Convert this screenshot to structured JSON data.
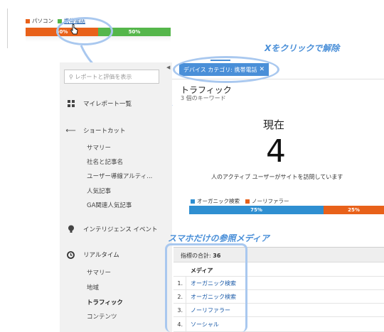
{
  "mini_chart": {
    "legend": [
      {
        "label": "パソコン",
        "color": "#e8611a"
      },
      {
        "label": "携帯電話",
        "color": "#55b64b"
      }
    ],
    "segments": [
      {
        "label": "50%",
        "value": 50,
        "color": "#e8611a"
      },
      {
        "label": "50%",
        "value": 50,
        "color": "#55b64b"
      }
    ]
  },
  "annotations": {
    "click_to_clear": "Xをクリックで解除",
    "smartphone_only": "スマホだけの参照メディア"
  },
  "filter_chip": {
    "label": "デバイス カテゴリ: 携帯電話",
    "close": "✕"
  },
  "sidebar": {
    "search_placeholder": "レポートと評価を表示",
    "my_reports": "マイレポート一覧",
    "shortcuts": "ショートカット",
    "shortcut_items": [
      "サマリー",
      "社名と記事名",
      "ユーザー導線アルティ...",
      "人気記事",
      "GA関連人気記事"
    ],
    "intelligence": "インテリジェンス イベント",
    "realtime": "リアルタイム",
    "realtime_items": [
      "サマリー",
      "地域",
      "トラフィック",
      "コンテンツ"
    ],
    "collapse": "◀"
  },
  "main": {
    "title": "トラフィック",
    "subtitle": "3 個のキーワード",
    "now_label": "現在",
    "now_value": "4",
    "now_desc": "人のアクティブ ユーザーがサイトを訪問しています"
  },
  "medium_chart": {
    "legend": [
      {
        "label": "オーガニック検索",
        "color": "#2f8fd1"
      },
      {
        "label": "ノーリファラー",
        "color": "#e8611a"
      }
    ],
    "segments": [
      {
        "label": "75%",
        "value": 75,
        "color": "#2f8fd1"
      },
      {
        "label": "25%",
        "value": 25,
        "color": "#e8611a"
      }
    ]
  },
  "table": {
    "total_label": "指標の合計: ",
    "total_value": "36",
    "column": "メディア",
    "rows": [
      {
        "num": "1.",
        "name": "オーガニック検索"
      },
      {
        "num": "2.",
        "name": "オーガニック検索"
      },
      {
        "num": "3.",
        "name": "ノーリファラー"
      },
      {
        "num": "4.",
        "name": "ソーシャル"
      }
    ]
  },
  "colors": {
    "accent_blue": "#4a8fd8",
    "annotation_ring": "#a9c8ef"
  }
}
